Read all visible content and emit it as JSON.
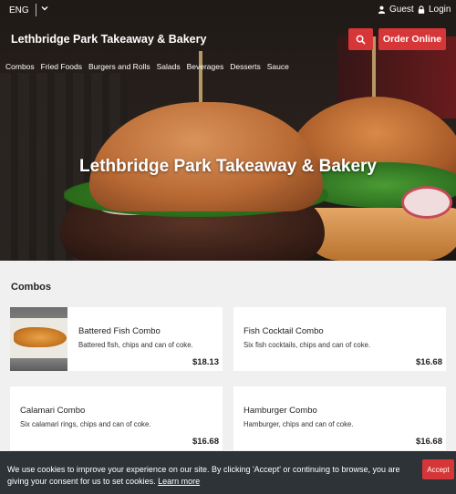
{
  "header": {
    "language": "ENG",
    "guest_label": "Guest",
    "login_label": "Login",
    "brand": "Lethbridge Park Takeaway & Bakery",
    "order_button": "Order Online"
  },
  "nav": {
    "items": [
      "Combos",
      "Fried Foods",
      "Burgers and Rolls",
      "Salads",
      "Beverages",
      "Desserts",
      "Sauce"
    ]
  },
  "hero": {
    "title": "Lethbridge Park Takeaway & Bakery"
  },
  "menu": {
    "section_title": "Combos",
    "items": [
      {
        "name": "Battered Fish Combo",
        "description": "Battered fish, chips and can of coke.",
        "price": "$18.13"
      },
      {
        "name": "Fish Cocktail Combo",
        "description": "Six fish cocktails, chips and can of coke.",
        "price": "$16.68"
      },
      {
        "name": "Calamari Combo",
        "description": "Six calamari rings, chips and can of coke.",
        "price": "$16.68"
      },
      {
        "name": "Hamburger Combo",
        "description": "Hamburger, chips and can of coke.",
        "price": "$16.68"
      }
    ]
  },
  "cookie": {
    "text": "We use cookies to improve your experience on our site. By clicking 'Accept' or continuing to browse, you are giving your consent for us to set cookies.",
    "link": "Learn more",
    "accept": "Accept"
  },
  "colors": {
    "accent": "#d63638",
    "cookie_bg": "#2e3338"
  },
  "icons": {
    "lang": "chevron-down-icon",
    "guest": "user-icon",
    "login": "lock-icon",
    "search": "search-icon"
  }
}
